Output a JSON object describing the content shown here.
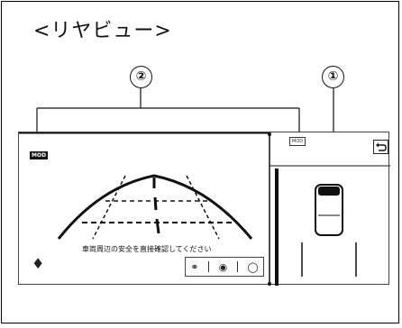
{
  "heading": "<リヤビュー>",
  "callouts": {
    "one": "①",
    "two": "②"
  },
  "screen": {
    "mod_badge_left": "MOD",
    "mod_badge_right": "MOD",
    "message": "車両周辺の安全を直接確認してください"
  },
  "icons": {
    "back": "back-arrow-icon",
    "person": "person-alert-icon",
    "camera_view": "camera-view-icon",
    "top_view": "top-view-icon",
    "display": "display-icon"
  },
  "colors": {
    "line": "#111111",
    "background": "#ffffff"
  }
}
